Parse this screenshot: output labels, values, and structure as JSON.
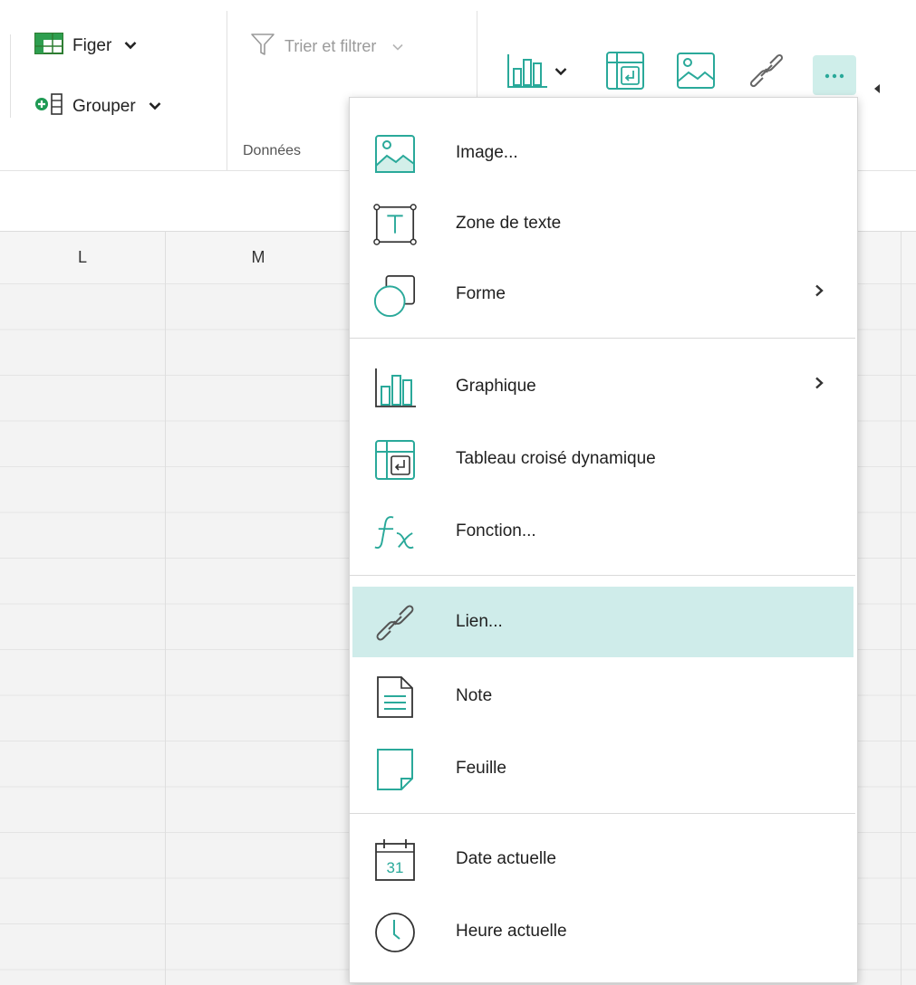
{
  "ribbon": {
    "freeze_label": "Figer",
    "group_label": "Grouper",
    "sort_filter_label": "Trier et filtrer",
    "data_group_caption": "Données"
  },
  "toolbar_icons": [
    "chart-icon",
    "pivot-table-icon",
    "image-icon",
    "link-icon",
    "more-icon"
  ],
  "columns": [
    "L",
    "M"
  ],
  "menu": {
    "items": [
      {
        "label": "Image...",
        "icon": "image-icon",
        "submenu": false
      },
      {
        "label": "Zone de texte",
        "icon": "text-box-icon",
        "submenu": false
      },
      {
        "label": "Forme",
        "icon": "shape-icon",
        "submenu": true
      },
      {
        "label": "Graphique",
        "icon": "chart-icon",
        "submenu": true
      },
      {
        "label": "Tableau croisé dynamique",
        "icon": "pivot-table-icon",
        "submenu": false
      },
      {
        "label": "Fonction...",
        "icon": "function-icon",
        "submenu": false
      },
      {
        "label": "Lien...",
        "icon": "link-icon",
        "submenu": false,
        "selected": true
      },
      {
        "label": "Note",
        "icon": "note-icon",
        "submenu": false
      },
      {
        "label": "Feuille",
        "icon": "sheet-icon",
        "submenu": false
      },
      {
        "label": "Date actuelle",
        "icon": "calendar-icon",
        "calendar_day": "31",
        "submenu": false
      },
      {
        "label": "Heure actuelle",
        "icon": "clock-icon",
        "submenu": false
      }
    ]
  },
  "colors": {
    "accent": "#2aa99a",
    "selected_bg": "#cfecea",
    "grid_bg": "#f3f3f3"
  }
}
